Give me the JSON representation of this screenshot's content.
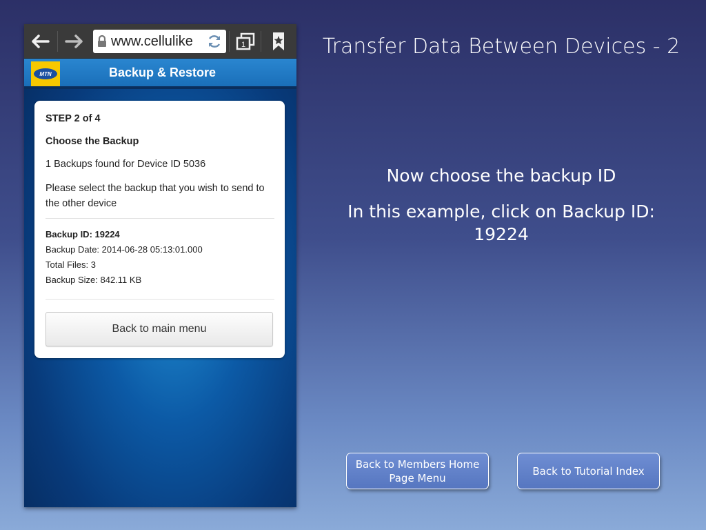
{
  "slide": {
    "title": "Transfer Data Between Devices - 2",
    "instruction": "Now choose the backup ID",
    "example": "In this example, click on Backup ID: 19224",
    "buttons": {
      "members": "Back to Members Home Page Menu",
      "index": "Back to Tutorial Index"
    }
  },
  "browser": {
    "url": "www.cellulike",
    "icons": [
      "back-arrow-icon",
      "forward-arrow-icon",
      "lock-icon",
      "reload-icon",
      "tabs-icon",
      "bookmark-icon"
    ],
    "tab_count": "1"
  },
  "app": {
    "logo_text": "MTN",
    "title": "Backup & Restore",
    "card": {
      "step": "STEP 2 of 4",
      "heading": "Choose the Backup",
      "found": "1 Backups found for Device ID 5036",
      "prompt": "Please select the backup that you wish to send to the other device",
      "backup": {
        "id": "Backup ID: 19224",
        "date": "Backup Date: 2014-06-28 05:13:01.000",
        "files": "Total Files: 3",
        "size": "Backup Size: 842.11 KB"
      },
      "main_menu_button": "Back to main menu"
    }
  },
  "colors": {
    "background_top": "#2c3067",
    "background_bottom": "#8aaad8",
    "app_header": "#1a6fb9",
    "mtn_yellow": "#f7c800"
  }
}
